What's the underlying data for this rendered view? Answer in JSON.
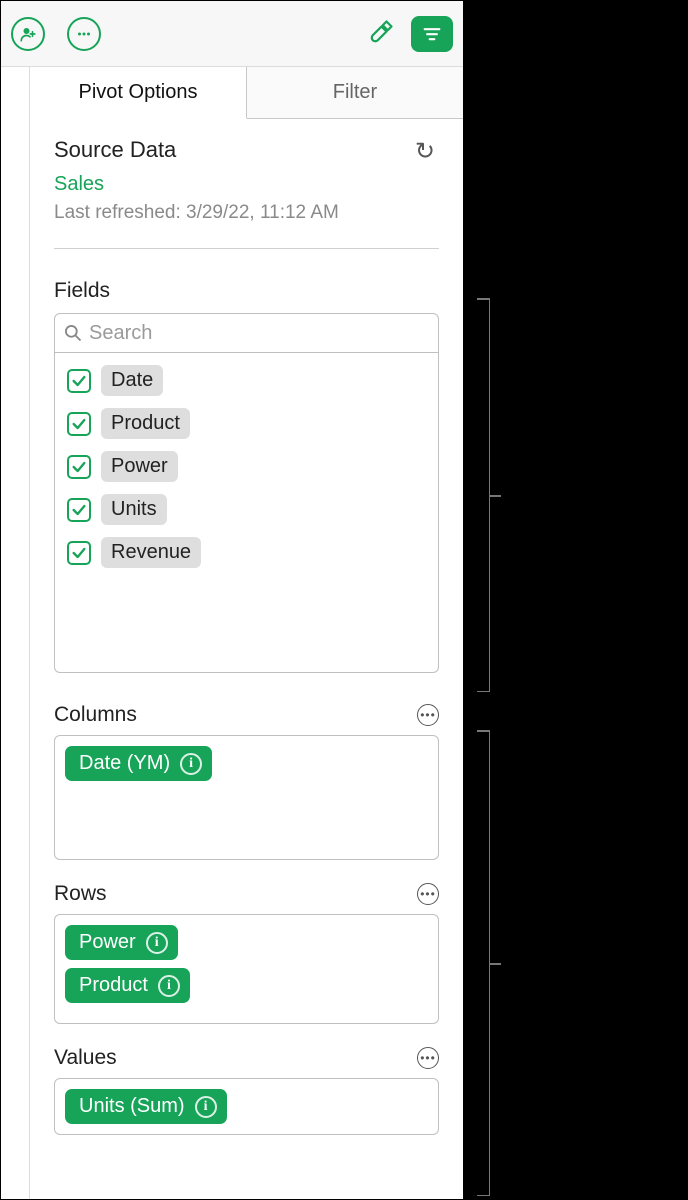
{
  "tabs": {
    "pivot": "Pivot Options",
    "filter": "Filter"
  },
  "source": {
    "heading": "Source Data",
    "name": "Sales",
    "refreshed": "Last refreshed: 3/29/22, 11:12 AM"
  },
  "fields": {
    "heading": "Fields",
    "search_placeholder": "Search",
    "items": [
      {
        "label": "Date",
        "checked": true
      },
      {
        "label": "Product",
        "checked": true
      },
      {
        "label": "Power",
        "checked": true
      },
      {
        "label": "Units",
        "checked": true
      },
      {
        "label": "Revenue",
        "checked": true
      }
    ]
  },
  "columns": {
    "heading": "Columns",
    "chips": [
      {
        "label": "Date (YM)"
      }
    ]
  },
  "rows": {
    "heading": "Rows",
    "chips": [
      {
        "label": "Power"
      },
      {
        "label": "Product"
      }
    ]
  },
  "values": {
    "heading": "Values",
    "chips": [
      {
        "label": "Units (Sum)"
      }
    ]
  }
}
